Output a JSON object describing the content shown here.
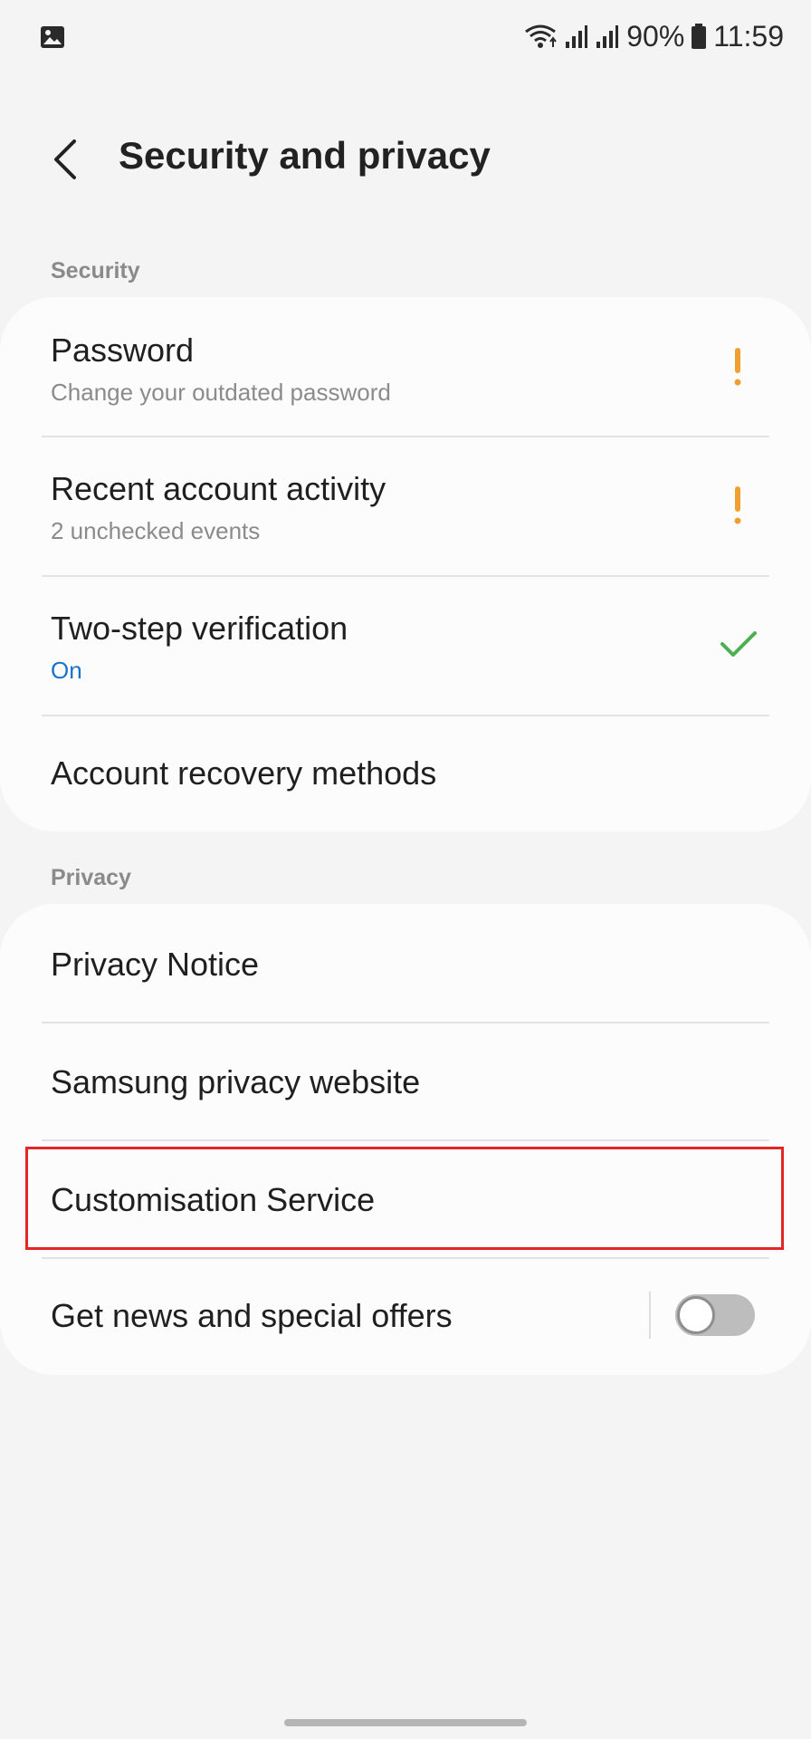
{
  "status_bar": {
    "battery": "90%",
    "time": "11:59",
    "icons": [
      "image-icon",
      "wifi-icon",
      "signal-icon",
      "signal-icon",
      "battery-icon"
    ]
  },
  "header": {
    "title": "Security and privacy",
    "back_icon": "chevron-left-icon"
  },
  "security": {
    "label": "Security",
    "items": [
      {
        "title": "Password",
        "subtitle": "Change your outdated password",
        "status_icon": "warning-icon"
      },
      {
        "title": "Recent account activity",
        "subtitle": "2 unchecked events",
        "status_icon": "warning-icon"
      },
      {
        "title": "Two-step verification",
        "subtitle": "On",
        "status_icon": "check-icon"
      },
      {
        "title": "Account recovery methods"
      }
    ]
  },
  "privacy": {
    "label": "Privacy",
    "items": [
      {
        "title": "Privacy Notice"
      },
      {
        "title": "Samsung privacy website"
      },
      {
        "title": "Customisation Service",
        "highlighted": true
      },
      {
        "title": "Get news and special offers",
        "toggle": "off"
      }
    ]
  },
  "colors": {
    "background": "#f4f4f4",
    "card": "#fcfcfc",
    "warning": "#f0a030",
    "check": "#4caf50",
    "link_blue": "#1a73c8",
    "highlight": "#e32727"
  }
}
